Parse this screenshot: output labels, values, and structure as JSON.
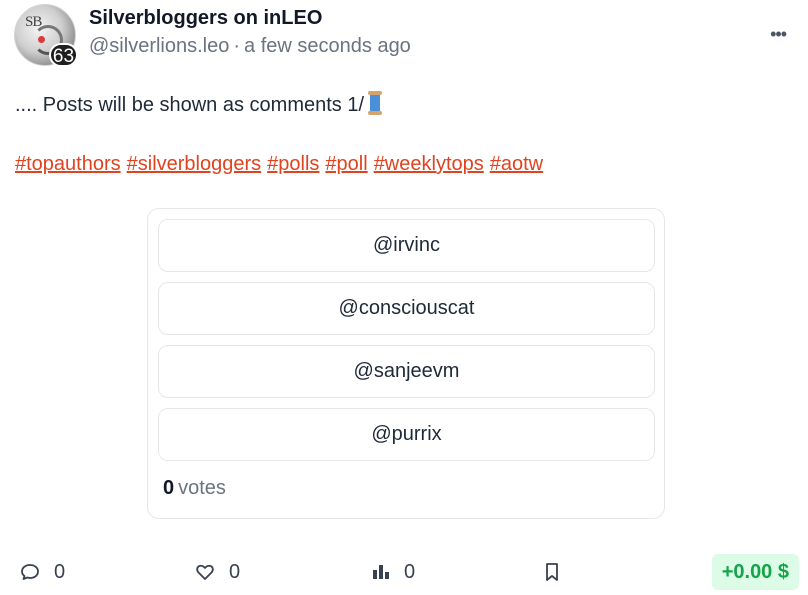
{
  "post": {
    "author_name": "Silverbloggers on inLEO",
    "handle": "@silverlions.leo",
    "separator": "·",
    "time_ago": "a few seconds ago",
    "reputation": "63",
    "avatar_mark": "SB",
    "more_label": "•••",
    "body_text": ".... Posts will be shown as comments 1/",
    "body_icon": "spool-of-thread-icon",
    "tags": [
      "#topauthors",
      "#silverbloggers",
      "#polls",
      "#poll",
      "#weeklytops",
      "#aotw"
    ]
  },
  "poll": {
    "options": [
      "@irvinc",
      "@consciouscat",
      "@sanjeevm",
      "@purrix"
    ],
    "vote_count": "0",
    "vote_label": "votes"
  },
  "actions": {
    "comments": {
      "icon": "comment-icon",
      "count": "0"
    },
    "likes": {
      "icon": "heart-icon",
      "count": "0"
    },
    "stats": {
      "icon": "bar-chart-icon",
      "count": "0"
    },
    "bookmark": {
      "icon": "bookmark-icon"
    },
    "payout": "+0.00 $"
  },
  "colors": {
    "tag": "#e0431f",
    "payout_bg": "#dcfce7",
    "payout_text": "#16a34a",
    "muted_text": "#6b7280"
  }
}
